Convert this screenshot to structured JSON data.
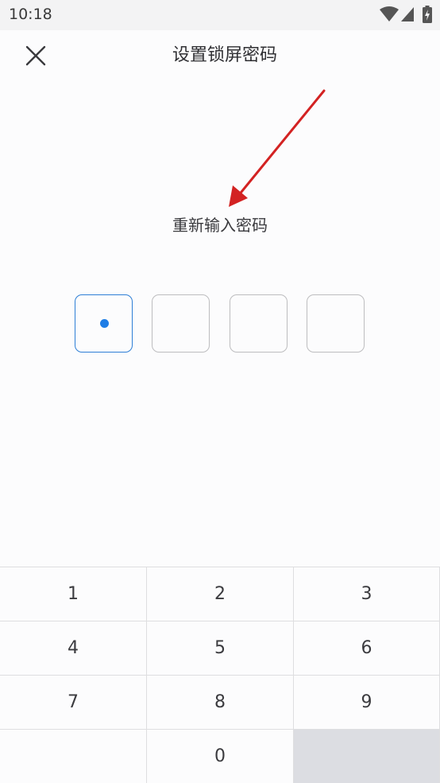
{
  "status_bar": {
    "time": "10:18",
    "icons": [
      "wifi-icon",
      "cellular-signal-icon",
      "battery-charging-icon"
    ]
  },
  "header": {
    "title": "设置锁屏密码",
    "close_icon": "close-icon"
  },
  "annotation": {
    "type": "arrow",
    "color": "#d32222",
    "points_to": "prompt"
  },
  "prompt": "重新输入密码",
  "pin": {
    "length": 4,
    "entered": 1,
    "active_color": "#1f7ee6"
  },
  "keypad": {
    "keys": [
      {
        "label": "1"
      },
      {
        "label": "2"
      },
      {
        "label": "3"
      },
      {
        "label": "4"
      },
      {
        "label": "5"
      },
      {
        "label": "6"
      },
      {
        "label": "7"
      },
      {
        "label": "8"
      },
      {
        "label": "9"
      },
      {
        "label": ""
      },
      {
        "label": "0"
      },
      {
        "label": ""
      }
    ]
  }
}
